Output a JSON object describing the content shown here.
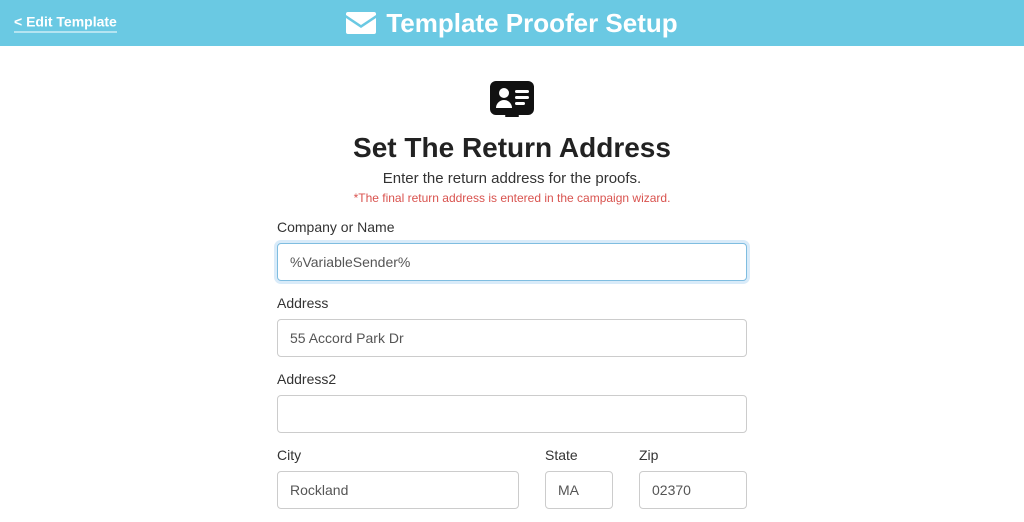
{
  "header": {
    "edit_link": "< Edit Template",
    "title": "Template Proofer Setup"
  },
  "section": {
    "heading": "Set The Return Address",
    "subtext": "Enter the return address for the proofs.",
    "note": "*The final return address is entered in the campaign wizard."
  },
  "form": {
    "company": {
      "label": "Company or Name",
      "value": "%VariableSender%"
    },
    "address": {
      "label": "Address",
      "value": "55 Accord Park Dr"
    },
    "address2": {
      "label": "Address2",
      "value": ""
    },
    "city": {
      "label": "City",
      "value": "Rockland"
    },
    "state": {
      "label": "State",
      "value": "MA"
    },
    "zip": {
      "label": "Zip",
      "value": "02370"
    }
  }
}
